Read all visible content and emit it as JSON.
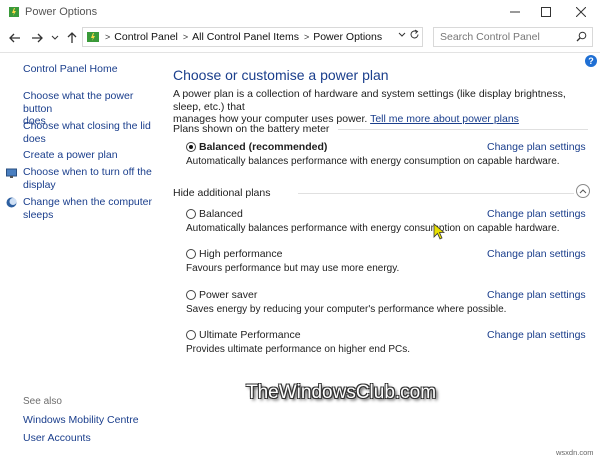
{
  "window": {
    "title": "Power Options"
  },
  "address": {
    "crumbs": [
      "Control Panel",
      "All Control Panel Items",
      "Power Options"
    ]
  },
  "search": {
    "placeholder": "Search Control Panel"
  },
  "sidebar": {
    "home": "Control Panel Home",
    "links": [
      {
        "line1": "Choose what the power button",
        "line2": "does"
      },
      {
        "line1": "Choose what closing the lid",
        "line2": "does"
      },
      {
        "line1": "Create a power plan",
        "line2": ""
      },
      {
        "line1": "Choose when to turn off the",
        "line2": "display",
        "icon": "monitor-icon"
      },
      {
        "line1": "Change when the computer",
        "line2": "sleeps",
        "icon": "moon-icon"
      }
    ],
    "see_also_label": "See also",
    "see_also": [
      "Windows Mobility Centre",
      "User Accounts"
    ]
  },
  "main": {
    "heading": "Choose or customise a power plan",
    "desc_line1": "A power plan is a collection of hardware and system settings (like display brightness, sleep, etc.) that",
    "desc_line2": "manages how your computer uses power.",
    "desc_link": "Tell me more about power plans",
    "battery_section": "Plans shown on the battery meter",
    "hide_section": "Hide additional plans",
    "change_label": "Change plan settings",
    "primary_plan": {
      "name": "Balanced (recommended)",
      "desc": "Automatically balances performance with energy consumption on capable hardware.",
      "selected": true
    },
    "additional_plans": [
      {
        "name": "Balanced",
        "desc": "Automatically balances performance with energy consumption on capable hardware.",
        "selected": false
      },
      {
        "name": "High performance",
        "desc": "Favours performance but may use more energy.",
        "selected": false
      },
      {
        "name": "Power saver",
        "desc": "Saves energy by reducing your computer's performance where possible.",
        "selected": false
      },
      {
        "name": "Ultimate Performance",
        "desc": "Provides ultimate performance on higher end PCs.",
        "selected": false
      }
    ]
  },
  "watermark": "TheWindowsClub.com",
  "credit": "wsxdn.com",
  "colors": {
    "link": "#1a3e8c",
    "help": "#1f6fd4"
  }
}
